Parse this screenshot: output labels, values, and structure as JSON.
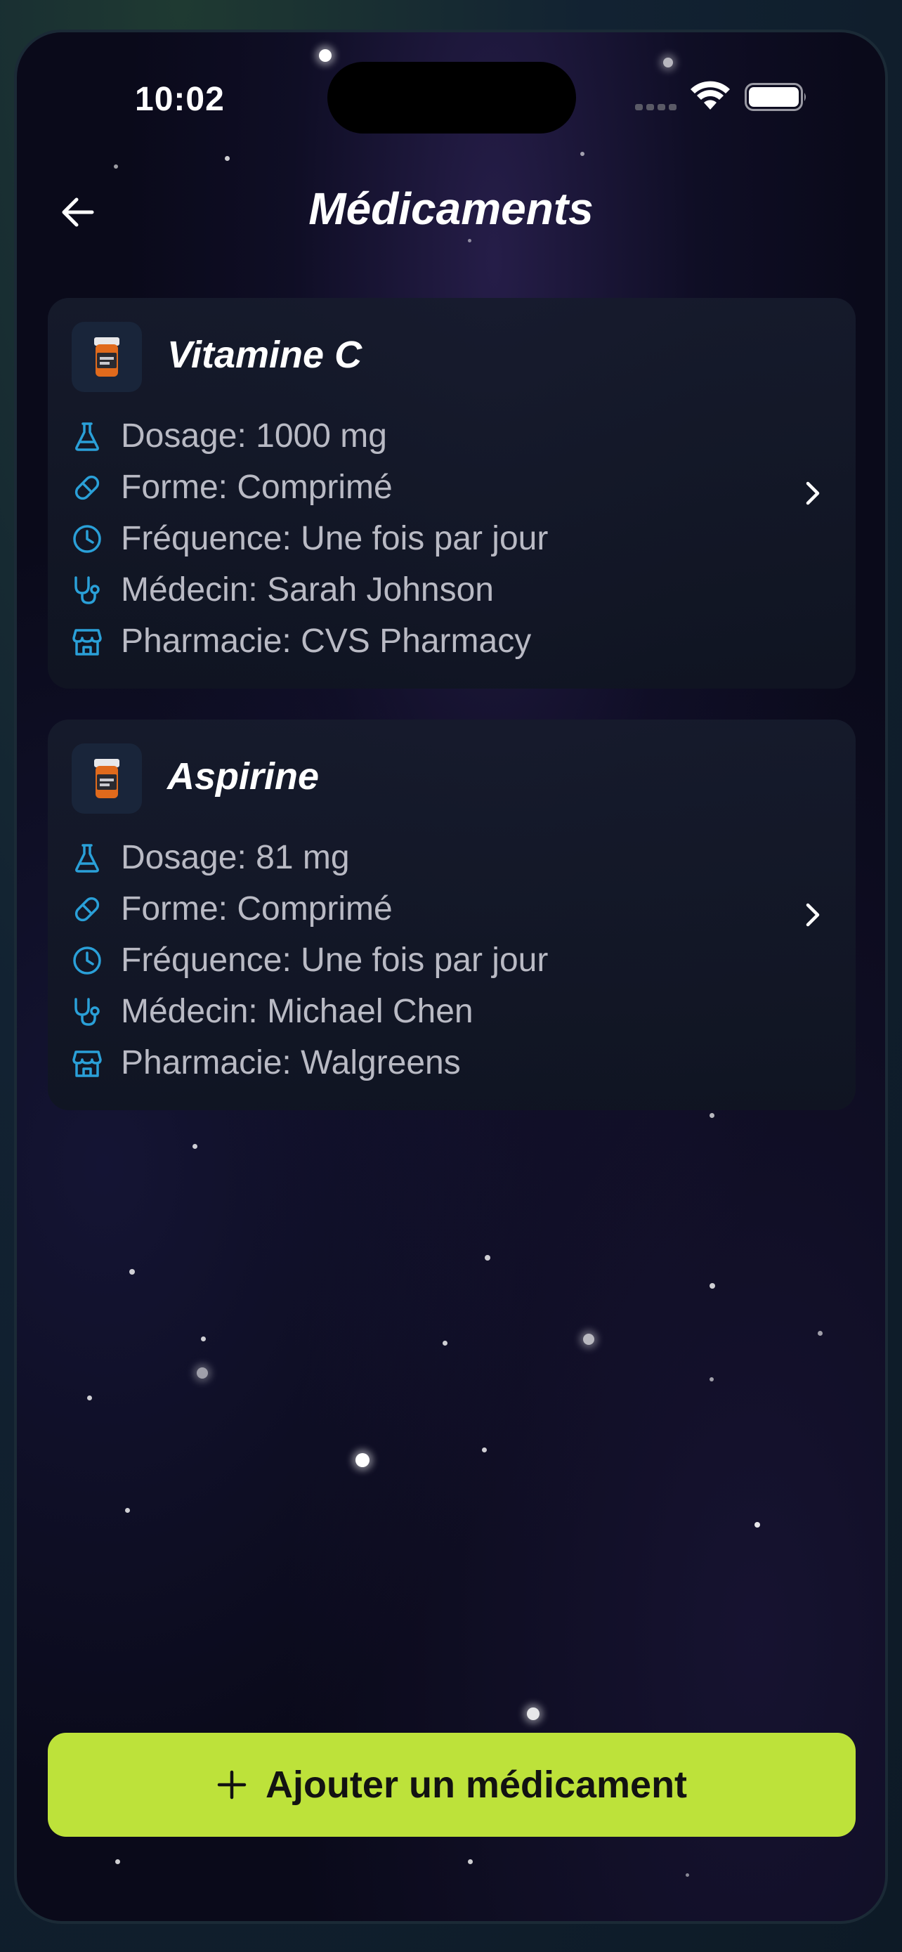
{
  "status_bar": {
    "time": "10:02",
    "signal_icon": "cellular-signal-icon",
    "wifi_icon": "wifi-icon",
    "battery_icon": "battery-icon"
  },
  "header": {
    "back_icon": "arrow-left-icon",
    "title": "Médicaments"
  },
  "medications": [
    {
      "name": "Vitamine C",
      "icon": "pill-bottle-icon",
      "rows": [
        {
          "icon": "flask-icon",
          "text": "Dosage: 1000 mg"
        },
        {
          "icon": "pill-icon",
          "text": "Forme: Comprimé"
        },
        {
          "icon": "clock-icon",
          "text": "Fréquence: Une fois par jour"
        },
        {
          "icon": "stethoscope-icon",
          "text": "Médecin: Sarah Johnson"
        },
        {
          "icon": "store-icon",
          "text": "Pharmacie: CVS Pharmacy"
        }
      ],
      "chevron_icon": "chevron-right-icon"
    },
    {
      "name": "Aspirine",
      "icon": "pill-bottle-icon",
      "rows": [
        {
          "icon": "flask-icon",
          "text": "Dosage: 81 mg"
        },
        {
          "icon": "pill-icon",
          "text": "Forme: Comprimé"
        },
        {
          "icon": "clock-icon",
          "text": "Fréquence: Une fois par jour"
        },
        {
          "icon": "stethoscope-icon",
          "text": "Médecin: Michael Chen"
        },
        {
          "icon": "store-icon",
          "text": "Pharmacie: Walgreens"
        }
      ],
      "chevron_icon": "chevron-right-icon"
    }
  ],
  "add_button": {
    "label": "Ajouter un médicament",
    "icon": "plus-icon"
  },
  "colors": {
    "background": "#0a0a1a",
    "card": "#161b2c",
    "accent_icon": "#2aa0d8",
    "button": "#bde23a",
    "button_text": "#121212",
    "row_text": "#b9bac4"
  }
}
